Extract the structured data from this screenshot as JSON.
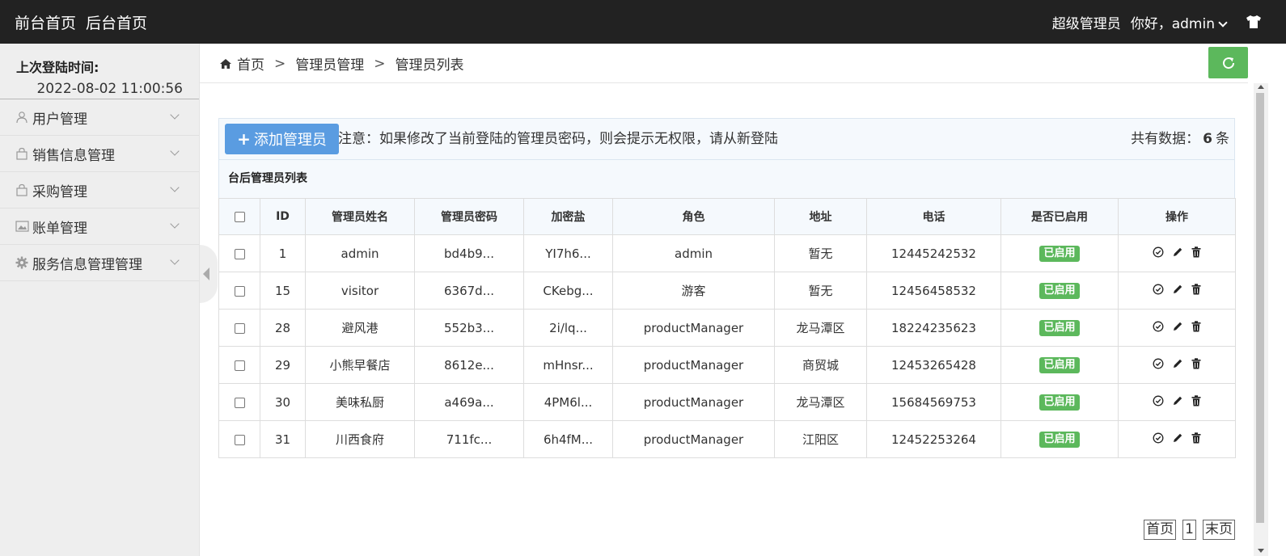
{
  "header": {
    "nav": [
      "前台首页",
      "后台首页"
    ],
    "role": "超级管理员",
    "greeting": "你好，admin"
  },
  "sidebar": {
    "last_login_label": "上次登陆时间:",
    "last_login_time": "2022-08-02 11:00:56",
    "items": [
      {
        "label": "用户管理",
        "icon": "user-icon"
      },
      {
        "label": "销售信息管理",
        "icon": "bag-icon"
      },
      {
        "label": "采购管理",
        "icon": "bag-icon"
      },
      {
        "label": "账单管理",
        "icon": "image-icon"
      },
      {
        "label": "服务信息管理管理",
        "icon": "gear-icon"
      }
    ]
  },
  "breadcrumb": [
    "首页",
    "管理员管理",
    "管理员列表"
  ],
  "toolbar": {
    "add_label": "添加管理员",
    "notice": "注意：如果修改了当前登陆的管理员密码，则会提示无权限，请从新登陆",
    "total_prefix": "共有数据：",
    "total_count": "6",
    "total_suffix": "条"
  },
  "table": {
    "title": "台后管理员列表",
    "columns": [
      "ID",
      "管理员姓名",
      "管理员密码",
      "加密盐",
      "角色",
      "地址",
      "电话",
      "是否已启用",
      "操作"
    ],
    "rows": [
      {
        "id": "1",
        "name": "admin",
        "password": "bd4b9...",
        "salt": "YI7h6...",
        "role": "admin",
        "address": "暂无",
        "phone": "12445242532",
        "status": "已启用"
      },
      {
        "id": "15",
        "name": "visitor",
        "password": "6367d...",
        "salt": "CKebg...",
        "role": "游客",
        "address": "暂无",
        "phone": "12456458532",
        "status": "已启用"
      },
      {
        "id": "28",
        "name": "避风港",
        "password": "552b3...",
        "salt": "2i/lq...",
        "role": "productManager",
        "address": "龙马潭区",
        "phone": "18224235623",
        "status": "已启用"
      },
      {
        "id": "29",
        "name": "小熊早餐店",
        "password": "8612e...",
        "salt": "mHnsr...",
        "role": "productManager",
        "address": "商贸城",
        "phone": "12453265428",
        "status": "已启用"
      },
      {
        "id": "30",
        "name": "美味私厨",
        "password": "a469a...",
        "salt": "4PM6l...",
        "role": "productManager",
        "address": "龙马潭区",
        "phone": "15684569753",
        "status": "已启用"
      },
      {
        "id": "31",
        "name": "川西食府",
        "password": "711fc...",
        "salt": "6h4fM...",
        "role": "productManager",
        "address": "江阳区",
        "phone": "12452253264",
        "status": "已启用"
      }
    ]
  },
  "pager": {
    "first": "首页",
    "current": "1",
    "last": "末页"
  },
  "colors": {
    "header_bg": "#222222",
    "accent_green": "#5cb85c",
    "add_button_blue": "#5a9ce1"
  }
}
